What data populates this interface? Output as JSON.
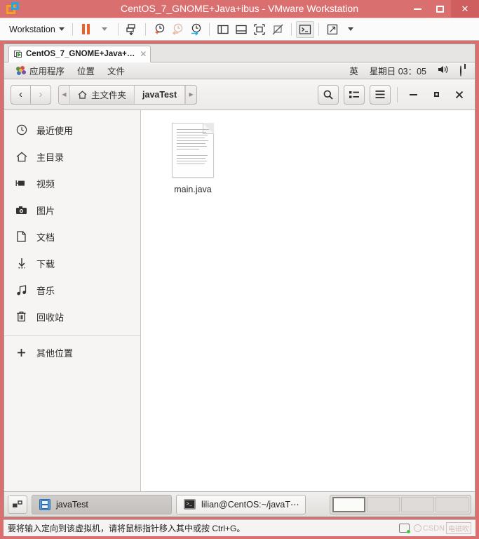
{
  "vmware": {
    "title": "CentOS_7_GNOME+Java+ibus - VMware Workstation",
    "logo_icon": "vmware-logo-icon",
    "window_controls": {
      "minimize": "minimize-icon",
      "maximize": "maximize-icon",
      "close": "✕"
    },
    "toolbar": {
      "menu_label": "Workstation",
      "buttons": [
        {
          "name": "pause-vm-button",
          "icon": "pause-icon"
        },
        {
          "name": "pause-dropdown-button",
          "icon": "chevron-down-icon"
        },
        {
          "name": "suspend-button",
          "icon": "suspend-icon"
        },
        {
          "name": "snapshot-take-button",
          "icon": "snapshot-add-icon"
        },
        {
          "name": "snapshot-revert-button",
          "icon": "snapshot-revert-icon"
        },
        {
          "name": "snapshot-manager-button",
          "icon": "snapshot-manager-icon"
        },
        {
          "name": "show-sidebar-button",
          "icon": "sidebar-panel-icon"
        },
        {
          "name": "show-thumbnail-bar-button",
          "icon": "thumbnail-bar-icon"
        },
        {
          "name": "fullscreen-button",
          "icon": "fullscreen-icon"
        },
        {
          "name": "unity-mode-button",
          "icon": "unity-mode-icon"
        },
        {
          "name": "console-view-button",
          "icon": "console-prompt-icon"
        },
        {
          "name": "stretch-view-button",
          "icon": "stretch-arrow-icon"
        },
        {
          "name": "stretch-dropdown-button",
          "icon": "chevron-down-icon"
        }
      ]
    },
    "tab": {
      "label": "CentOS_7_GNOME+Java+…",
      "icon": "vm-screen-play-icon",
      "close": "✕"
    },
    "statusbar": {
      "message": "要将输入定向到该虚拟机，请将鼠标指针移入其中或按 Ctrl+G。",
      "disk_icon": "disk-activity-icon",
      "watermark_text": "CSDN",
      "watermark_suffix": "电磁吹"
    }
  },
  "gnome_panel": {
    "menus": [
      "应用程序",
      "位置",
      "文件"
    ],
    "foot_icon": "gnome-foot-icon",
    "input_method": "英",
    "clock": "星期日 03：05",
    "volume_icon": "volume-icon",
    "power_icon": "power-icon"
  },
  "nautilus": {
    "nav": {
      "back": "‹",
      "forward": "›"
    },
    "pathbar": {
      "left_arrow": "◀",
      "right_arrow": "▶",
      "crumbs": [
        {
          "label": "主文件夹",
          "icon": "home-icon",
          "current": false
        },
        {
          "label": "javaTest",
          "icon": "",
          "current": true
        }
      ]
    },
    "header_buttons": [
      {
        "name": "search-button",
        "icon": "search-icon"
      },
      {
        "name": "view-list-button",
        "icon": "list-view-icon"
      },
      {
        "name": "main-menu-button",
        "icon": "hamburger-menu-icon"
      }
    ],
    "window_controls": {
      "minimize": "minimize-icon",
      "maximize": "maximize-icon",
      "close": "close-icon"
    },
    "sidebar": {
      "items": [
        {
          "label": "最近使用",
          "icon": "clock-icon"
        },
        {
          "label": "主目录",
          "icon": "home-icon"
        },
        {
          "label": "视频",
          "icon": "video-camera-icon"
        },
        {
          "label": "图片",
          "icon": "camera-icon"
        },
        {
          "label": "文档",
          "icon": "document-icon"
        },
        {
          "label": "下载",
          "icon": "download-arrow-icon"
        },
        {
          "label": "音乐",
          "icon": "music-note-icon"
        },
        {
          "label": "回收站",
          "icon": "trash-icon"
        }
      ],
      "other_locations": {
        "label": "其他位置",
        "icon": "plus-icon"
      }
    },
    "files": [
      {
        "name": "main.java",
        "icon": "text-document-icon"
      }
    ]
  },
  "taskbar": {
    "show_desktop_icon": "show-desktop-icon",
    "windows": [
      {
        "label": "javaTest",
        "icon": "file-manager-icon",
        "active": true
      },
      {
        "label": "lilian@CentOS:~/javaT⋯",
        "icon": "terminal-icon",
        "active": false
      }
    ],
    "workspaces": [
      {
        "name": "workspace-1",
        "active": true
      },
      {
        "name": "workspace-2",
        "active": false
      },
      {
        "name": "workspace-3",
        "active": false
      },
      {
        "name": "workspace-4",
        "active": false
      }
    ]
  },
  "colors": {
    "vmware_chrome": "#d9706f",
    "accent_orange": "#e8622a",
    "accent_blue": "#1aabe3"
  }
}
